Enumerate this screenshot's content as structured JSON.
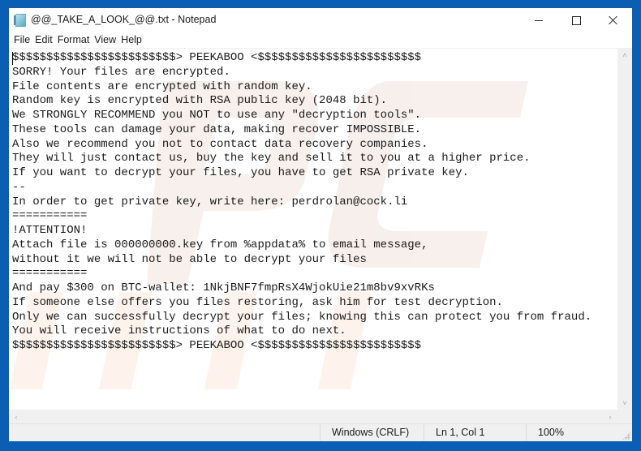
{
  "window": {
    "title": "@@_TAKE_A_LOOK_@@.txt - Notepad",
    "icon": "notepad-icon",
    "controls": {
      "minimize": "minimize-icon",
      "maximize": "maximize-icon",
      "close": "close-icon"
    }
  },
  "menu": {
    "items": [
      {
        "label": "File"
      },
      {
        "label": "Edit"
      },
      {
        "label": "Format"
      },
      {
        "label": "View"
      },
      {
        "label": "Help"
      }
    ]
  },
  "editor": {
    "text": "$$$$$$$$$$$$$$$$$$$$$$$$> PEEKABOO <$$$$$$$$$$$$$$$$$$$$$$$$\nSORRY! Your files are encrypted.\nFile contents are encrypted with random key.\nRandom key is encrypted with RSA public key (2048 bit).\nWe STRONGLY RECOMMEND you NOT to use any \"decryption tools\".\nThese tools can damage your data, making recover IMPOSSIBLE.\nAlso we recommend you not to contact data recovery companies.\nThey will just contact us, buy the key and sell it to you at a higher price.\nIf you want to decrypt your files, you have to get RSA private key.\n--\nIn order to get private key, write here: perdrolan@cock.li\n===========\n!ATTENTION!\nAttach file is 000000000.key from %appdata% to email message,\nwithout it we will not be able to decrypt your files\n===========\nAnd pay $300 on BTC-wallet: 1NkjBNF7fmpRsX4WjokUie21m8bv9xvRKs\nIf someone else offers you files restoring, ask him for test decryption.\nOnly we can successfully decrypt your files; knowing this can protect you from fraud.\nYou will receive instructions of what to do next.\n$$$$$$$$$$$$$$$$$$$$$$$$> PEEKABOO <$$$$$$$$$$$$$$$$$$$$$$$$",
    "watermark": "PCrisk.com"
  },
  "scrollbars": {
    "up": "˄",
    "down": "˅",
    "left": "‹",
    "right": "›"
  },
  "status": {
    "line_ending": "Windows (CRLF)",
    "position": "Ln 1, Col 1",
    "zoom": "100%"
  },
  "colors": {
    "desktop": "#0a5fb4",
    "chrome": "#f0f0f0"
  }
}
